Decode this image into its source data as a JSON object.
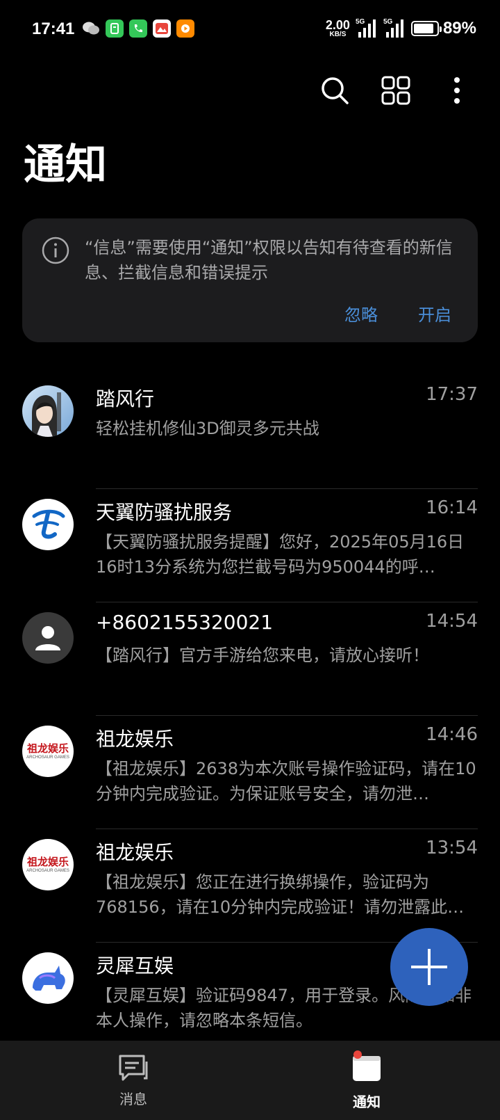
{
  "status_bar": {
    "time": "17:41",
    "speed_value": "2.00",
    "speed_unit": "KB/S",
    "net1_tag": "5G",
    "net2_tag": "5G",
    "battery_percent": "89%",
    "battery_level": 0.89,
    "app_icons": [
      "wechat-icon",
      "sms-app-icon",
      "phone-icon",
      "gallery-app-icon",
      "video-app-icon"
    ]
  },
  "toolbar": {
    "icons": [
      "search-icon",
      "grid-icon",
      "more-vertical-icon"
    ]
  },
  "page": {
    "title": "通知"
  },
  "notice": {
    "text": "“信息”需要使用“通知”权限以告知有待查看的新信息、拦截信息和错误提示",
    "ignore_label": "忽略",
    "enable_label": "开启",
    "accent_color": "#4a8ed8"
  },
  "messages": [
    {
      "name": "踏风行",
      "time": "17:37",
      "preview": "轻松挂机修仙3D御灵多元共战",
      "avatar": "game-character-avatar"
    },
    {
      "name": "天翼防骚扰服务",
      "time": "16:14",
      "preview": "【天翼防骚扰服务提醒】您好，2025年05月16日 16时13分系统为您拦截号码为950044的呼…",
      "avatar": "china-telecom-logo"
    },
    {
      "name": "+8602155320021",
      "time": "14:54",
      "preview": "【踏风行】官方手游给您来电，请放心接听！",
      "avatar": "default-person-avatar"
    },
    {
      "name": "祖龙娱乐",
      "time": "14:46",
      "preview": "【祖龙娱乐】2638为本次账号操作验证码，请在10分钟内完成验证。为保证账号安全，请勿泄…",
      "avatar": "zulong-logo",
      "logo_text": "祖龙娱乐",
      "logo_sub": "ARCHOSAUR GAMES"
    },
    {
      "name": "祖龙娱乐",
      "time": "13:54",
      "preview": "【祖龙娱乐】您正在进行换绑操作，验证码为768156，请在10分钟内完成验证！请勿泄露此…",
      "avatar": "zulong-logo",
      "logo_text": "祖龙娱乐",
      "logo_sub": "ARCHOSAUR GAMES"
    },
    {
      "name": "灵犀互娱",
      "time": "",
      "preview": "【灵犀互娱】验证码9847，用于登录。风险，如非本人操作，请忽略本条短信。",
      "avatar": "rhino-logo"
    }
  ],
  "fab": {
    "icon": "plus-icon",
    "color": "#2e62bc"
  },
  "bottom_nav": {
    "messages_label": "消息",
    "notifications_label": "通知",
    "active": "notifications",
    "badge_color": "#e8453c"
  }
}
